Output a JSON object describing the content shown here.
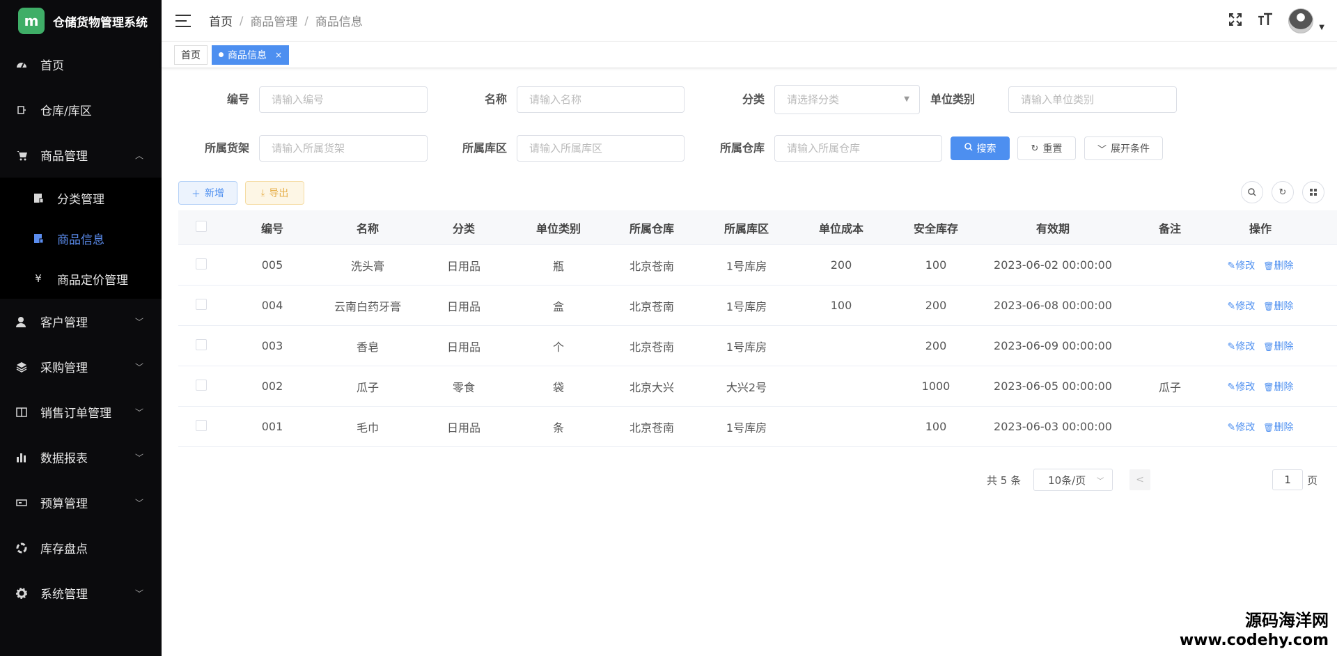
{
  "app": {
    "logo_text": "m",
    "title": "仓储货物管理系统"
  },
  "sidebar": {
    "items": [
      {
        "label": "首页",
        "icon": "dashboard-icon"
      },
      {
        "label": "仓库/库区",
        "icon": "warehouse-icon"
      },
      {
        "label": "商品管理",
        "icon": "cart-icon",
        "expanded": true,
        "children": [
          {
            "label": "分类管理",
            "icon": "category-icon"
          },
          {
            "label": "商品信息",
            "icon": "goods-icon",
            "active": true
          },
          {
            "label": "商品定价管理",
            "icon": "yen-icon"
          }
        ]
      },
      {
        "label": "客户管理",
        "icon": "user-icon"
      },
      {
        "label": "采购管理",
        "icon": "layers-icon"
      },
      {
        "label": "销售订单管理",
        "icon": "book-icon"
      },
      {
        "label": "数据报表",
        "icon": "bar-chart-icon"
      },
      {
        "label": "预算管理",
        "icon": "budget-icon"
      },
      {
        "label": "库存盘点",
        "icon": "inventory-icon"
      },
      {
        "label": "系统管理",
        "icon": "gear-icon"
      }
    ]
  },
  "header": {
    "breadcrumb": [
      "首页",
      "商品管理",
      "商品信息"
    ],
    "separator": "/"
  },
  "tags": [
    {
      "label": "首页",
      "active": false
    },
    {
      "label": "商品信息",
      "active": true,
      "close": "×"
    }
  ],
  "search": {
    "fields": [
      {
        "label": "编号",
        "placeholder": "请输入编号"
      },
      {
        "label": "名称",
        "placeholder": "请输入名称"
      },
      {
        "label": "分类",
        "placeholder": "请选择分类",
        "type": "select"
      },
      {
        "label": "单位类别",
        "placeholder": "请输入单位类别"
      },
      {
        "label": "所属货架",
        "placeholder": "请输入所属货架"
      },
      {
        "label": "所属库区",
        "placeholder": "请输入所属库区"
      },
      {
        "label": "所属仓库",
        "placeholder": "请输入所属仓库"
      }
    ],
    "search_label": "搜索",
    "reset_label": "重置",
    "expand_label": "展开条件"
  },
  "toolbar": {
    "add_label": "新增",
    "export_label": "导出"
  },
  "table": {
    "columns": [
      "编号",
      "名称",
      "分类",
      "单位类别",
      "所属仓库",
      "所属库区",
      "单位成本",
      "安全库存",
      "有效期",
      "备注",
      "操作"
    ],
    "rows": [
      [
        "005",
        "洗头膏",
        "日用品",
        "瓶",
        "北京苍南",
        "1号库房",
        "200",
        "100",
        "2023-06-02 00:00:00",
        ""
      ],
      [
        "004",
        "云南白药牙膏",
        "日用品",
        "盒",
        "北京苍南",
        "1号库房",
        "100",
        "200",
        "2023-06-08 00:00:00",
        ""
      ],
      [
        "003",
        "香皂",
        "日用品",
        "个",
        "北京苍南",
        "1号库房",
        "",
        "200",
        "2023-06-09 00:00:00",
        ""
      ],
      [
        "002",
        "瓜子",
        "零食",
        "袋",
        "北京大兴",
        "大兴2号",
        "",
        "1000",
        "2023-06-05 00:00:00",
        "瓜子"
      ],
      [
        "001",
        "毛巾",
        "日用品",
        "条",
        "北京苍南",
        "1号库房",
        "",
        "100",
        "2023-06-03 00:00:00",
        ""
      ]
    ],
    "edit_label": "修改",
    "delete_label": "删除"
  },
  "pagination": {
    "total_text": "共 5 条",
    "page_size": "10条/页",
    "prev": "<",
    "jump_value": "1",
    "page_unit": "页"
  },
  "watermark": {
    "cn": "源码海洋网",
    "en": "www.codehy.com"
  },
  "colors": {
    "primary": "#4d8ff0",
    "sidebar_bg": "#0b0b0d",
    "logo_green": "#3fae67"
  }
}
